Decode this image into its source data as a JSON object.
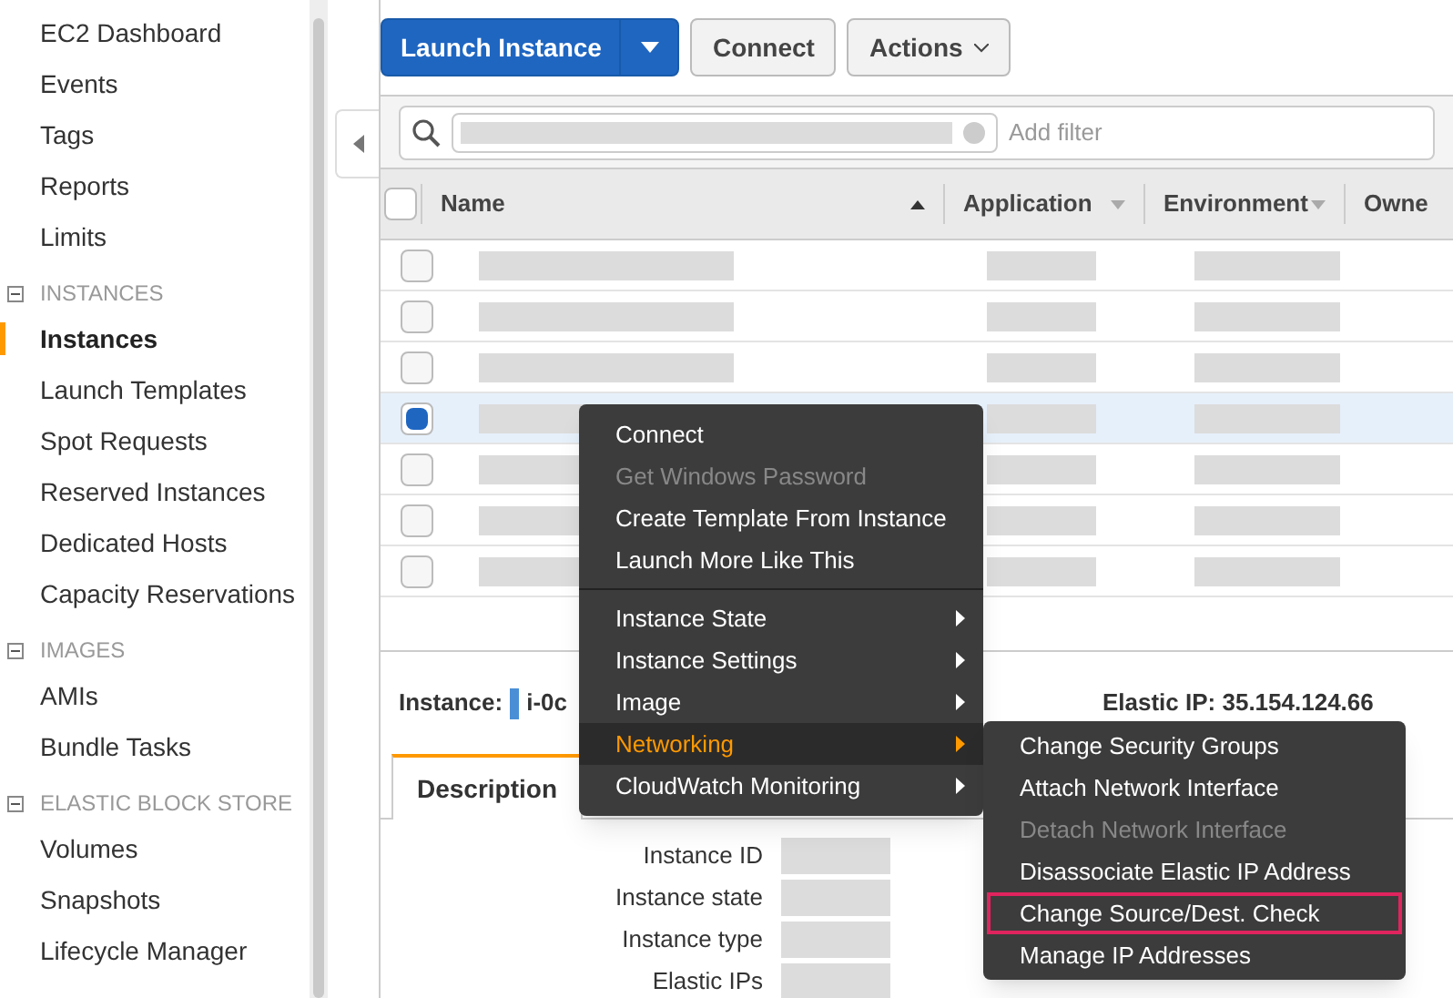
{
  "sidebar": {
    "items": [
      {
        "label": "EC2 Dashboard",
        "selected": false
      },
      {
        "label": "Events",
        "selected": false
      },
      {
        "label": "Tags",
        "selected": false
      },
      {
        "label": "Reports",
        "selected": false
      },
      {
        "label": "Limits",
        "selected": false
      }
    ],
    "sections": [
      {
        "title": "INSTANCES",
        "expanded": true,
        "items": [
          {
            "label": "Instances",
            "selected": true
          },
          {
            "label": "Launch Templates",
            "selected": false
          },
          {
            "label": "Spot Requests",
            "selected": false
          },
          {
            "label": "Reserved Instances",
            "selected": false
          },
          {
            "label": "Dedicated Hosts",
            "selected": false
          },
          {
            "label": "Capacity Reservations",
            "selected": false
          }
        ]
      },
      {
        "title": "IMAGES",
        "expanded": true,
        "items": [
          {
            "label": "AMIs",
            "selected": false
          },
          {
            "label": "Bundle Tasks",
            "selected": false
          }
        ]
      },
      {
        "title": "ELASTIC BLOCK STORE",
        "expanded": true,
        "items": [
          {
            "label": "Volumes",
            "selected": false
          },
          {
            "label": "Snapshots",
            "selected": false
          },
          {
            "label": "Lifecycle Manager",
            "selected": false
          }
        ]
      }
    ]
  },
  "toolbar": {
    "launch": "Launch Instance",
    "connect": "Connect",
    "actions": "Actions"
  },
  "search": {
    "placeholder": "Add filter"
  },
  "table": {
    "columns": [
      {
        "label": "Name",
        "sorted": true
      },
      {
        "label": "Application",
        "sorted": false
      },
      {
        "label": "Environment",
        "sorted": false
      },
      {
        "label": "Owne"
      }
    ],
    "all_selected": false,
    "rows": [
      {
        "selected": false
      },
      {
        "selected": false
      },
      {
        "selected": false
      },
      {
        "selected": true
      },
      {
        "selected": false
      },
      {
        "selected": false
      },
      {
        "selected": false
      }
    ]
  },
  "context_menu": {
    "items": [
      {
        "label": "Connect",
        "disabled": false,
        "submenu": false,
        "selected": false,
        "separator_before": false
      },
      {
        "label": "Get Windows Password",
        "disabled": true,
        "submenu": false,
        "selected": false,
        "separator_before": false
      },
      {
        "label": "Create Template From Instance",
        "disabled": false,
        "submenu": false,
        "selected": false,
        "separator_before": false
      },
      {
        "label": "Launch More Like This",
        "disabled": false,
        "submenu": false,
        "selected": false,
        "separator_before": false
      },
      {
        "label": "Instance State",
        "disabled": false,
        "submenu": true,
        "selected": false,
        "separator_before": true
      },
      {
        "label": "Instance Settings",
        "disabled": false,
        "submenu": true,
        "selected": false,
        "separator_before": false
      },
      {
        "label": "Image",
        "disabled": false,
        "submenu": true,
        "selected": false,
        "separator_before": false
      },
      {
        "label": "Networking",
        "disabled": false,
        "submenu": true,
        "selected": true,
        "separator_before": false
      },
      {
        "label": "CloudWatch Monitoring",
        "disabled": false,
        "submenu": true,
        "selected": false,
        "separator_before": false
      }
    ]
  },
  "submenu": {
    "items": [
      {
        "label": "Change Security Groups",
        "disabled": false,
        "outlined": false
      },
      {
        "label": "Attach Network Interface",
        "disabled": false,
        "outlined": false
      },
      {
        "label": "Detach Network Interface",
        "disabled": true,
        "outlined": false
      },
      {
        "label": "Disassociate Elastic IP Address",
        "disabled": false,
        "outlined": false
      },
      {
        "label": "Change Source/Dest. Check",
        "disabled": false,
        "outlined": true
      },
      {
        "label": "Manage IP Addresses",
        "disabled": false,
        "outlined": false
      }
    ]
  },
  "details": {
    "instance_label": "Instance:",
    "instance_id": "i-0c",
    "elastic_ip": "Elastic IP: 35.154.124.66",
    "tabs": [
      {
        "label": "Description",
        "selected": true
      }
    ],
    "fields": [
      "Instance ID",
      "Instance state",
      "Instance type",
      "Elastic IPs"
    ]
  }
}
